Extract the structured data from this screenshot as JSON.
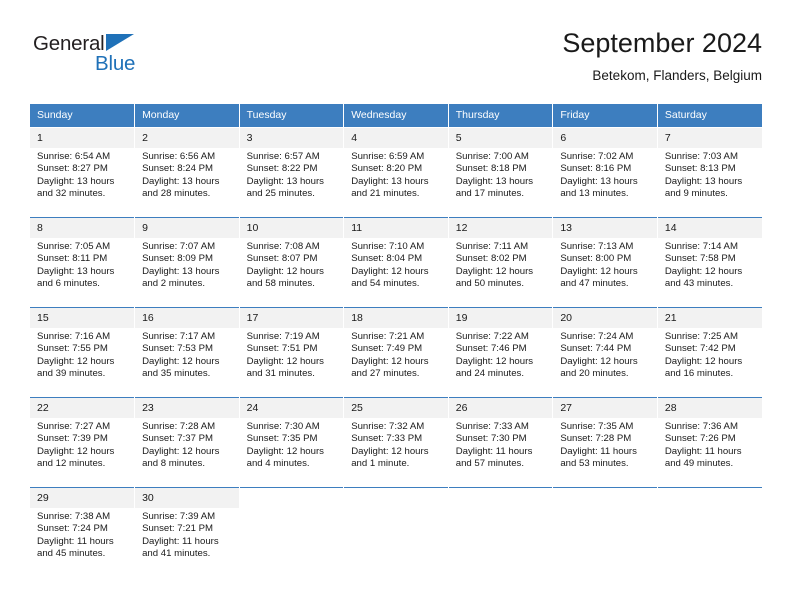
{
  "logo": {
    "word_black": "General",
    "word_blue": "Blue",
    "mark": "triangle-flag-icon",
    "accent_color": "#1f71b8"
  },
  "header": {
    "title": "September 2024",
    "subtitle": "Betekom, Flanders, Belgium"
  },
  "theme": {
    "header_blue": "#3d7ebf",
    "daynum_band": "#f2f2f2",
    "text": "#1a1a1a"
  },
  "weekday_headers": [
    "Sunday",
    "Monday",
    "Tuesday",
    "Wednesday",
    "Thursday",
    "Friday",
    "Saturday"
  ],
  "labels": {
    "sunrise": "Sunrise:",
    "sunset": "Sunset:",
    "daylight": "Daylight:"
  },
  "weeks": [
    [
      {
        "day": "1",
        "sunrise": "Sunrise: 6:54 AM",
        "sunset": "Sunset: 8:27 PM",
        "daylight1": "Daylight: 13 hours",
        "daylight2": "and 32 minutes."
      },
      {
        "day": "2",
        "sunrise": "Sunrise: 6:56 AM",
        "sunset": "Sunset: 8:24 PM",
        "daylight1": "Daylight: 13 hours",
        "daylight2": "and 28 minutes."
      },
      {
        "day": "3",
        "sunrise": "Sunrise: 6:57 AM",
        "sunset": "Sunset: 8:22 PM",
        "daylight1": "Daylight: 13 hours",
        "daylight2": "and 25 minutes."
      },
      {
        "day": "4",
        "sunrise": "Sunrise: 6:59 AM",
        "sunset": "Sunset: 8:20 PM",
        "daylight1": "Daylight: 13 hours",
        "daylight2": "and 21 minutes."
      },
      {
        "day": "5",
        "sunrise": "Sunrise: 7:00 AM",
        "sunset": "Sunset: 8:18 PM",
        "daylight1": "Daylight: 13 hours",
        "daylight2": "and 17 minutes."
      },
      {
        "day": "6",
        "sunrise": "Sunrise: 7:02 AM",
        "sunset": "Sunset: 8:16 PM",
        "daylight1": "Daylight: 13 hours",
        "daylight2": "and 13 minutes."
      },
      {
        "day": "7",
        "sunrise": "Sunrise: 7:03 AM",
        "sunset": "Sunset: 8:13 PM",
        "daylight1": "Daylight: 13 hours",
        "daylight2": "and 9 minutes."
      }
    ],
    [
      {
        "day": "8",
        "sunrise": "Sunrise: 7:05 AM",
        "sunset": "Sunset: 8:11 PM",
        "daylight1": "Daylight: 13 hours",
        "daylight2": "and 6 minutes."
      },
      {
        "day": "9",
        "sunrise": "Sunrise: 7:07 AM",
        "sunset": "Sunset: 8:09 PM",
        "daylight1": "Daylight: 13 hours",
        "daylight2": "and 2 minutes."
      },
      {
        "day": "10",
        "sunrise": "Sunrise: 7:08 AM",
        "sunset": "Sunset: 8:07 PM",
        "daylight1": "Daylight: 12 hours",
        "daylight2": "and 58 minutes."
      },
      {
        "day": "11",
        "sunrise": "Sunrise: 7:10 AM",
        "sunset": "Sunset: 8:04 PM",
        "daylight1": "Daylight: 12 hours",
        "daylight2": "and 54 minutes."
      },
      {
        "day": "12",
        "sunrise": "Sunrise: 7:11 AM",
        "sunset": "Sunset: 8:02 PM",
        "daylight1": "Daylight: 12 hours",
        "daylight2": "and 50 minutes."
      },
      {
        "day": "13",
        "sunrise": "Sunrise: 7:13 AM",
        "sunset": "Sunset: 8:00 PM",
        "daylight1": "Daylight: 12 hours",
        "daylight2": "and 47 minutes."
      },
      {
        "day": "14",
        "sunrise": "Sunrise: 7:14 AM",
        "sunset": "Sunset: 7:58 PM",
        "daylight1": "Daylight: 12 hours",
        "daylight2": "and 43 minutes."
      }
    ],
    [
      {
        "day": "15",
        "sunrise": "Sunrise: 7:16 AM",
        "sunset": "Sunset: 7:55 PM",
        "daylight1": "Daylight: 12 hours",
        "daylight2": "and 39 minutes."
      },
      {
        "day": "16",
        "sunrise": "Sunrise: 7:17 AM",
        "sunset": "Sunset: 7:53 PM",
        "daylight1": "Daylight: 12 hours",
        "daylight2": "and 35 minutes."
      },
      {
        "day": "17",
        "sunrise": "Sunrise: 7:19 AM",
        "sunset": "Sunset: 7:51 PM",
        "daylight1": "Daylight: 12 hours",
        "daylight2": "and 31 minutes."
      },
      {
        "day": "18",
        "sunrise": "Sunrise: 7:21 AM",
        "sunset": "Sunset: 7:49 PM",
        "daylight1": "Daylight: 12 hours",
        "daylight2": "and 27 minutes."
      },
      {
        "day": "19",
        "sunrise": "Sunrise: 7:22 AM",
        "sunset": "Sunset: 7:46 PM",
        "daylight1": "Daylight: 12 hours",
        "daylight2": "and 24 minutes."
      },
      {
        "day": "20",
        "sunrise": "Sunrise: 7:24 AM",
        "sunset": "Sunset: 7:44 PM",
        "daylight1": "Daylight: 12 hours",
        "daylight2": "and 20 minutes."
      },
      {
        "day": "21",
        "sunrise": "Sunrise: 7:25 AM",
        "sunset": "Sunset: 7:42 PM",
        "daylight1": "Daylight: 12 hours",
        "daylight2": "and 16 minutes."
      }
    ],
    [
      {
        "day": "22",
        "sunrise": "Sunrise: 7:27 AM",
        "sunset": "Sunset: 7:39 PM",
        "daylight1": "Daylight: 12 hours",
        "daylight2": "and 12 minutes."
      },
      {
        "day": "23",
        "sunrise": "Sunrise: 7:28 AM",
        "sunset": "Sunset: 7:37 PM",
        "daylight1": "Daylight: 12 hours",
        "daylight2": "and 8 minutes."
      },
      {
        "day": "24",
        "sunrise": "Sunrise: 7:30 AM",
        "sunset": "Sunset: 7:35 PM",
        "daylight1": "Daylight: 12 hours",
        "daylight2": "and 4 minutes."
      },
      {
        "day": "25",
        "sunrise": "Sunrise: 7:32 AM",
        "sunset": "Sunset: 7:33 PM",
        "daylight1": "Daylight: 12 hours",
        "daylight2": "and 1 minute."
      },
      {
        "day": "26",
        "sunrise": "Sunrise: 7:33 AM",
        "sunset": "Sunset: 7:30 PM",
        "daylight1": "Daylight: 11 hours",
        "daylight2": "and 57 minutes."
      },
      {
        "day": "27",
        "sunrise": "Sunrise: 7:35 AM",
        "sunset": "Sunset: 7:28 PM",
        "daylight1": "Daylight: 11 hours",
        "daylight2": "and 53 minutes."
      },
      {
        "day": "28",
        "sunrise": "Sunrise: 7:36 AM",
        "sunset": "Sunset: 7:26 PM",
        "daylight1": "Daylight: 11 hours",
        "daylight2": "and 49 minutes."
      }
    ],
    [
      {
        "day": "29",
        "sunrise": "Sunrise: 7:38 AM",
        "sunset": "Sunset: 7:24 PM",
        "daylight1": "Daylight: 11 hours",
        "daylight2": "and 45 minutes."
      },
      {
        "day": "30",
        "sunrise": "Sunrise: 7:39 AM",
        "sunset": "Sunset: 7:21 PM",
        "daylight1": "Daylight: 11 hours",
        "daylight2": "and 41 minutes."
      },
      {
        "day": "",
        "sunrise": "",
        "sunset": "",
        "daylight1": "",
        "daylight2": ""
      },
      {
        "day": "",
        "sunrise": "",
        "sunset": "",
        "daylight1": "",
        "daylight2": ""
      },
      {
        "day": "",
        "sunrise": "",
        "sunset": "",
        "daylight1": "",
        "daylight2": ""
      },
      {
        "day": "",
        "sunrise": "",
        "sunset": "",
        "daylight1": "",
        "daylight2": ""
      },
      {
        "day": "",
        "sunrise": "",
        "sunset": "",
        "daylight1": "",
        "daylight2": ""
      }
    ]
  ]
}
